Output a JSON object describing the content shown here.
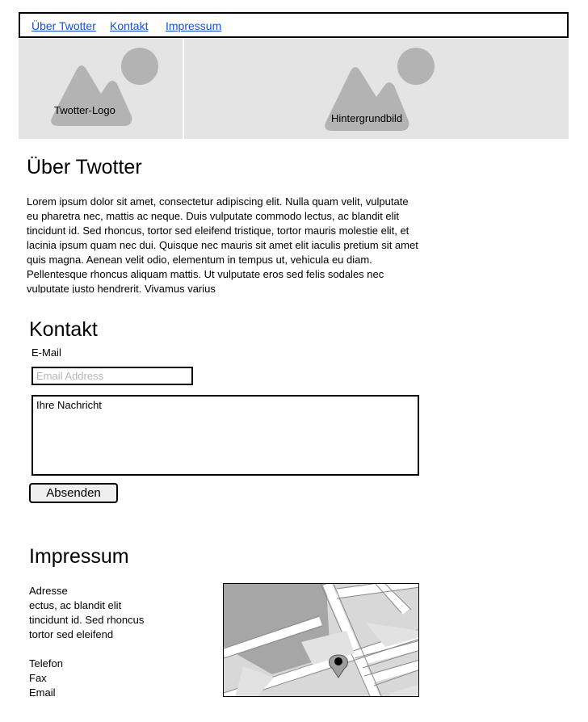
{
  "nav": {
    "items": [
      {
        "label": "Über Twotter"
      },
      {
        "label": "Kontakt"
      },
      {
        "label": "Impressum"
      }
    ]
  },
  "header": {
    "logo_label": "Twotter-Logo",
    "background_label": "Hintergrundbild"
  },
  "about": {
    "title": "Über Twotter",
    "text": "Lorem ipsum dolor sit amet, consectetur adipiscing elit. Nulla quam velit, vulputate eu pharetra nec, mattis ac neque. Duis vulputate commodo lectus, ac blandit elit tincidunt id. Sed rhoncus, tortor sed eleifend tristique, tortor mauris molestie elit, et lacinia ipsum quam nec dui. Quisque nec mauris sit amet elit iaculis pretium sit amet quis magna. Aenean velit odio, elementum in tempus ut, vehicula eu diam. Pellentesque rhoncus aliquam mattis. Ut vulputate eros sed felis sodales nec vulputate justo hendrerit. Vivamus varius"
  },
  "contact": {
    "title": "Kontakt",
    "email_label": "E-Mail",
    "email_placeholder": "Email Address",
    "message_value": "Ihre Nachricht",
    "submit_label": "Absenden"
  },
  "impressum": {
    "title": "Impressum",
    "address_label": "Adresse",
    "address_lines": [
      "ectus, ac blandit elit",
      "tincidunt id. Sed rhoncus",
      "tortor sed eleifend"
    ],
    "phone_label": "Telefon",
    "fax_label": "Fax",
    "email_label": "Email"
  },
  "colors": {
    "link": "#1a4fd8",
    "placeholder_bg": "#e4e4e4",
    "placeholder_shape": "#b3b3b3"
  },
  "icons": {
    "image_placeholder": "image-placeholder-icon",
    "map": "map-icon",
    "map_pin": "map-pin-icon"
  }
}
